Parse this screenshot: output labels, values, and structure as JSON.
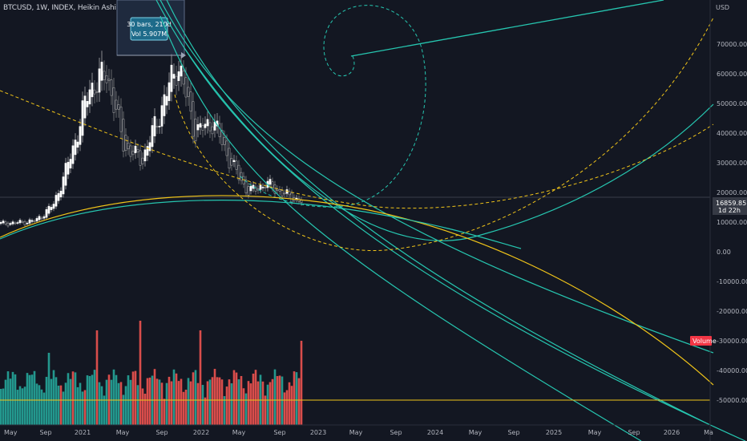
{
  "header": {
    "symbol_line": "BTCUSD, 1W, INDEX, Heikin Ashi",
    "currency": "USD"
  },
  "measure_tooltip": {
    "line1": "30 bars, 210d",
    "line2": "Vol 5.907M"
  },
  "price_tag": {
    "price": "16859.85",
    "countdown": "1d 22h",
    "color": "#363a45"
  },
  "volume_tag": {
    "label": "Volume",
    "color": "#f23645"
  },
  "y_axis_labels": [
    "70000.00",
    "60000.00",
    "50000.00",
    "40000.00",
    "30000.00",
    "20000.00",
    "10000.00",
    "0.00",
    "-10000.00",
    "-20000.00",
    "-30000.00",
    "-40000.00",
    "-50000.00"
  ],
  "x_axis_labels": [
    "May",
    "Sep",
    "2021",
    "May",
    "Sep",
    "2022",
    "May",
    "Sep",
    "2023",
    "May",
    "Sep",
    "2024",
    "May",
    "Sep",
    "2025",
    "May",
    "Sep",
    "2026",
    "Ma"
  ],
  "colors": {
    "background": "#131722",
    "teal": "#26a69a",
    "red": "#ef5350",
    "cyan_curve": "#26c6b0",
    "yellow": "#f0c419",
    "candle_white": "#d9d9d9"
  },
  "chart_data": {
    "type": "candlestick-heikin-ashi",
    "symbol": "BTCUSD",
    "interval": "1W",
    "y_range": [
      -55000,
      77000
    ],
    "approx_close_path": [
      {
        "t": "2020-05",
        "v": 9500
      },
      {
        "t": "2020-07",
        "v": 9800
      },
      {
        "t": "2020-09",
        "v": 10500
      },
      {
        "t": "2020-11",
        "v": 16000
      },
      {
        "t": "2021-01",
        "v": 33000
      },
      {
        "t": "2021-03",
        "v": 55000
      },
      {
        "t": "2021-04",
        "v": 60000
      },
      {
        "t": "2021-06",
        "v": 35000
      },
      {
        "t": "2021-07",
        "v": 31000
      },
      {
        "t": "2021-09",
        "v": 47000
      },
      {
        "t": "2021-11",
        "v": 64000
      },
      {
        "t": "2022-01",
        "v": 40000
      },
      {
        "t": "2022-03",
        "v": 44000
      },
      {
        "t": "2022-05",
        "v": 30000
      },
      {
        "t": "2022-06",
        "v": 20000
      },
      {
        "t": "2022-08",
        "v": 23000
      },
      {
        "t": "2022-10",
        "v": 19500
      },
      {
        "t": "2022-11",
        "v": 16859.85
      }
    ],
    "last_price": 16859.85
  }
}
